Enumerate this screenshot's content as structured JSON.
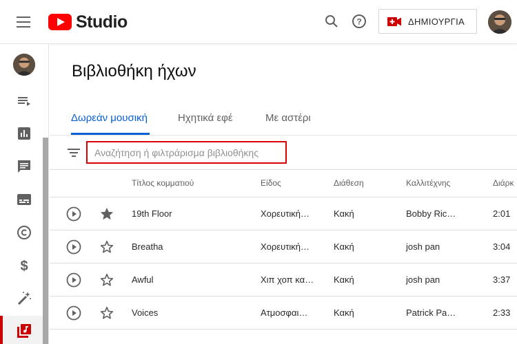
{
  "header": {
    "brand": "Studio",
    "create_label": "ΔΗΜΙΟΥΡΓΙΑ",
    "icons": {
      "menu": "hamburger-menu-icon",
      "search": "search-icon",
      "help": "help-icon",
      "create": "video-camera-plus-icon"
    }
  },
  "sidebar": {
    "items": [
      {
        "icon": "playlist-icon"
      },
      {
        "icon": "analytics-icon"
      },
      {
        "icon": "comments-icon"
      },
      {
        "icon": "subtitles-icon"
      },
      {
        "icon": "copyright-icon"
      },
      {
        "icon": "dollar-icon"
      },
      {
        "icon": "magic-wand-icon"
      },
      {
        "icon": "audio-library-icon",
        "active": true
      }
    ]
  },
  "page": {
    "title": "Βιβλιοθήκη ήχων"
  },
  "tabs": [
    {
      "label": "Δωρεάν μουσική",
      "active": true
    },
    {
      "label": "Ηχητικά εφέ",
      "active": false
    },
    {
      "label": "Με αστέρι",
      "active": false
    }
  ],
  "search": {
    "placeholder": "Αναζήτηση ή φιλτράρισμα βιβλιοθήκης",
    "value": ""
  },
  "table": {
    "columns": [
      "Τίτλος κομματιού",
      "Είδος",
      "Διάθεση",
      "Καλλιτέχνης",
      "Διάρκ"
    ],
    "rows": [
      {
        "title": "19th Floor",
        "genre": "Χορευτική…",
        "mood": "Κακή",
        "artist": "Bobby Ric…",
        "duration": "2:01",
        "starred": true
      },
      {
        "title": "Breatha",
        "genre": "Χορευτική…",
        "mood": "Κακή",
        "artist": "josh pan",
        "duration": "3:04",
        "starred": false
      },
      {
        "title": "Awful",
        "genre": "Χιπ χοπ κα…",
        "mood": "Κακή",
        "artist": "josh pan",
        "duration": "3:37",
        "starred": false
      },
      {
        "title": "Voices",
        "genre": "Ατμοσφαι…",
        "mood": "Κακή",
        "artist": "Patrick Pa…",
        "duration": "2:33",
        "starred": false
      }
    ]
  },
  "colors": {
    "accent": "#065fd4",
    "brand_red": "#ff0000",
    "active_red": "#cc0000",
    "search_border": "#d90000"
  }
}
